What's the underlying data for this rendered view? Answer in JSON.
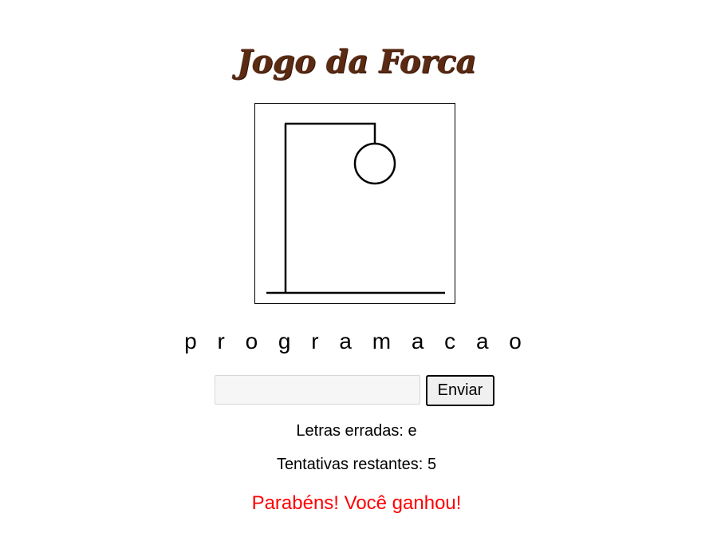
{
  "header": {
    "title": "Jogo da Forca"
  },
  "game": {
    "word_display": "p r o g r a m a c a o",
    "wrong_letters_label": "Letras erradas:",
    "wrong_letters": "e",
    "remaining_label": "Tentativas restantes:",
    "remaining": "5",
    "result_message": "Parabéns! Você ganhou!",
    "hangman_parts_drawn": [
      "base",
      "pole",
      "beam",
      "rope",
      "head"
    ]
  },
  "form": {
    "input_value": "",
    "input_placeholder": "",
    "submit_label": "Enviar"
  },
  "colors": {
    "title": "#5a2a12",
    "result": "#ff0000",
    "button_bg": "#f0f0f0",
    "input_bg": "#f6f6f6"
  }
}
